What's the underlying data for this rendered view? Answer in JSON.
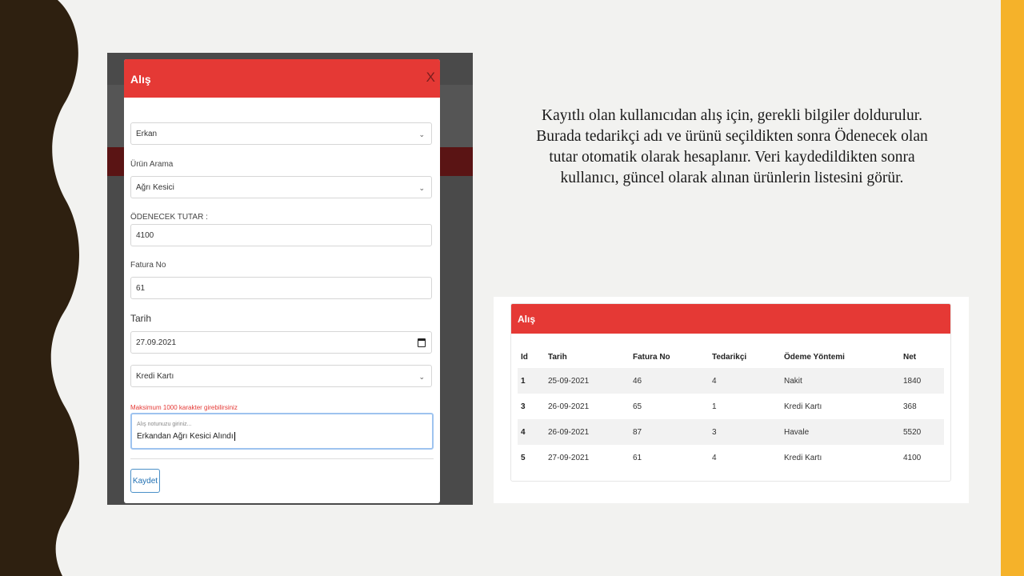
{
  "modal": {
    "title": "Alış",
    "close": "X",
    "supplier_value": "Erkan",
    "product_search_label": "Ürün Arama",
    "product_value": "Ağrı Kesici",
    "amount_label": "ÖDENECEK TUTAR :",
    "amount_value": "4100",
    "invoice_label": "Fatura No",
    "invoice_value": "61",
    "date_label": "Tarih",
    "date_value": "27.09.2021",
    "payment_value": "Kredi Kartı",
    "warning": "Maksimum 1000 karakter girebilirsiniz",
    "note_placeholder": "Alış notunuzu giriniz...",
    "note_value": "Erkandan Ağrı Kesici Alındı",
    "save_label": "Kaydet"
  },
  "description": "Kayıtlı olan kullanıcıdan alış için, gerekli bilgiler doldurulur. Burada tedarikçi adı ve ürünü seçildikten sonra Ödenecek olan tutar otomatik olarak hesaplanır. Veri kaydedildikten sonra kullanıcı, güncel olarak alınan ürünlerin listesini görür.",
  "purchases": {
    "title": "Alış",
    "columns": [
      "Id",
      "Tarih",
      "Fatura No",
      "Tedarikçi",
      "Ödeme Yöntemi",
      "Net"
    ],
    "rows": [
      [
        "1",
        "25-09-2021",
        "46",
        "4",
        "Nakit",
        "1840"
      ],
      [
        "3",
        "26-09-2021",
        "65",
        "1",
        "Kredi Kartı",
        "368"
      ],
      [
        "4",
        "26-09-2021",
        "87",
        "3",
        "Havale",
        "5520"
      ],
      [
        "5",
        "27-09-2021",
        "61",
        "4",
        "Kredi Kartı",
        "4100"
      ]
    ]
  },
  "colors": {
    "header_red": "#e53935",
    "left_band": "#2e2010",
    "right_band": "#f5b22a",
    "background": "#f2f2f0"
  }
}
